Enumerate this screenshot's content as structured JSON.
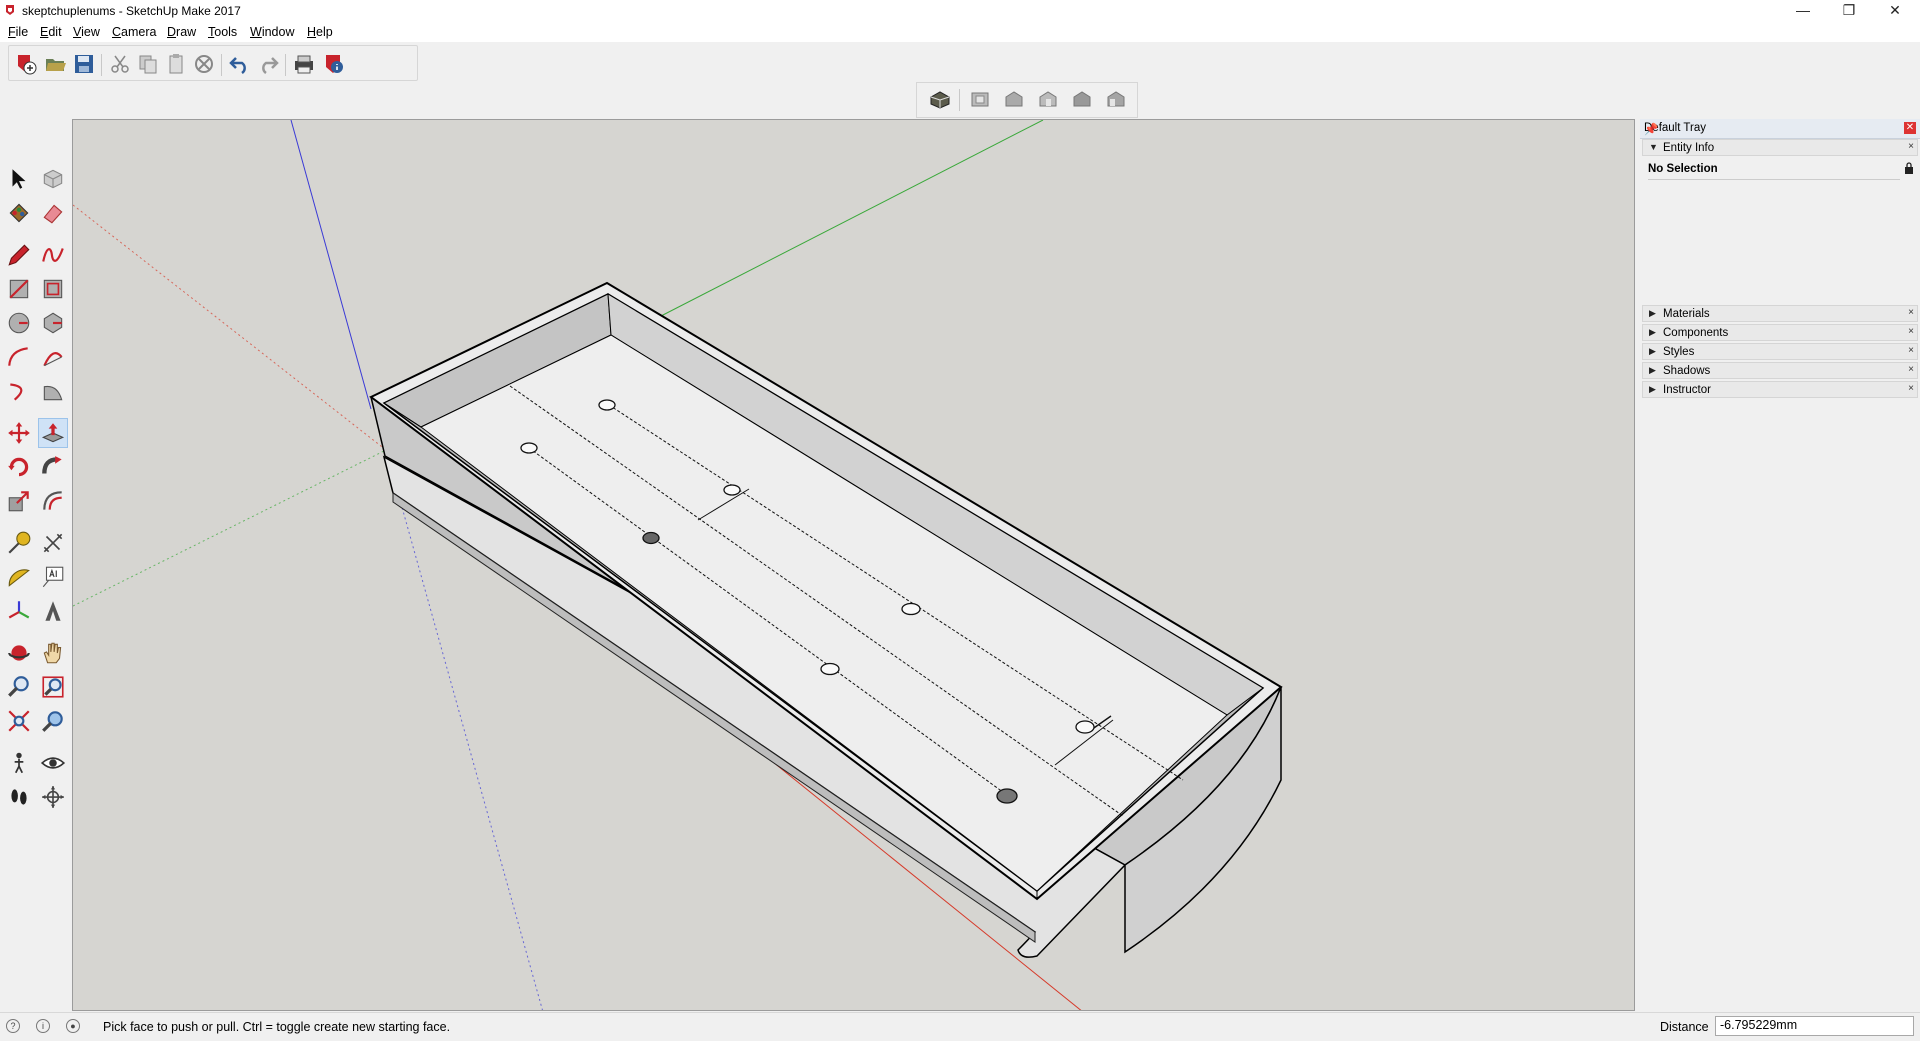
{
  "window": {
    "title": "skeptchuplenums - SketchUp Make 2017",
    "minimize": "—",
    "restore": "❐",
    "close": "✕"
  },
  "menu": [
    {
      "label": "File",
      "u": "F",
      "rest": "ile"
    },
    {
      "label": "Edit",
      "u": "E",
      "rest": "dit"
    },
    {
      "label": "View",
      "u": "V",
      "rest": "iew"
    },
    {
      "label": "Camera",
      "u": "C",
      "rest": "amera"
    },
    {
      "label": "Draw",
      "u": "D",
      "rest": "raw"
    },
    {
      "label": "Tools",
      "u": "T",
      "rest": "ools"
    },
    {
      "label": "Window",
      "u": "W",
      "rest": "indow"
    },
    {
      "label": "Help",
      "u": "H",
      "rest": "elp"
    }
  ],
  "tray": {
    "title": "Default Tray",
    "entity_info": {
      "label": "Entity Info",
      "selection": "No Selection"
    },
    "panels": [
      "Materials",
      "Components",
      "Styles",
      "Shadows",
      "Instructor"
    ]
  },
  "status": {
    "hint": "Pick face to push or pull.  Ctrl = toggle create new starting face.",
    "vcb_label": "Distance",
    "vcb_value": "-6.795229mm"
  },
  "colors": {
    "viewport_bg": "#d6d5d1",
    "axis_red": "#d63a2a",
    "axis_green": "#3aa83a",
    "axis_blue": "#3a3ad6",
    "accent_red": "#c8232c"
  }
}
